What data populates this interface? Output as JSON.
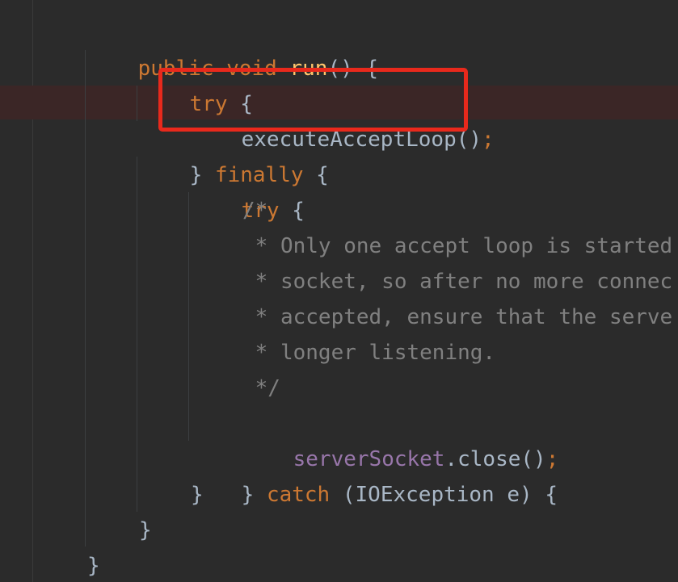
{
  "code": {
    "l1": {
      "kw1": "public",
      "kw2": "void",
      "fn": "run",
      "rest": "() {"
    },
    "l2": {
      "kw": "try",
      "rest": " {"
    },
    "l3": {
      "call": "executeAcceptLoop()",
      "semi": ";"
    },
    "l4": {
      "brace": "} ",
      "kw": "finally",
      "rest": " {"
    },
    "l5": {
      "kw": "try",
      "rest": " {"
    },
    "l6": {
      "comment": "/*"
    },
    "l7": {
      "comment": " * Only one accept loop is started"
    },
    "l8": {
      "comment": " * socket, so after no more connec"
    },
    "l9": {
      "comment": " * accepted, ensure that the serve"
    },
    "l10": {
      "comment": " * longer listening."
    },
    "l11": {
      "comment": " */"
    },
    "l12": {
      "field": "serverSocket",
      "call": ".close()",
      "semi": ";"
    },
    "l13": {
      "brace": "} ",
      "kw": "catch",
      "rest": " (IOException e) {"
    },
    "l14": {
      "brace": "}"
    },
    "l15": {
      "brace": "}"
    },
    "l16": {
      "brace": "}"
    }
  },
  "colors": {
    "background": "#2b2b2b",
    "keyword": "#cc7832",
    "method": "#ffc66d",
    "field": "#9876aa",
    "comment": "#808080",
    "text": "#a9b7c6",
    "highlight_box": "#e8291c",
    "breakpoint_line": "#3b2626"
  }
}
